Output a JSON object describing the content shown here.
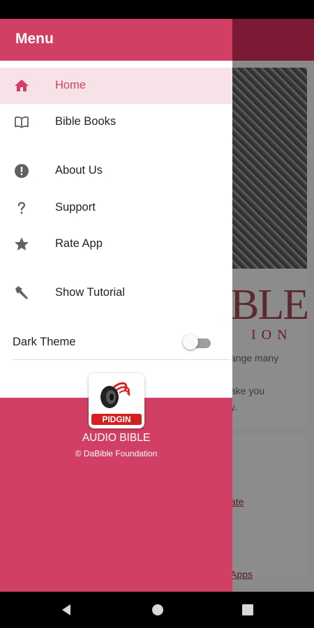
{
  "drawer": {
    "title": "Menu",
    "items": [
      {
        "label": "Home",
        "icon": "home-icon",
        "active": true
      },
      {
        "label": "Bible Books",
        "icon": "book-icon"
      },
      {
        "label": "About Us",
        "icon": "info-icon"
      },
      {
        "label": "Support",
        "icon": "question-icon"
      },
      {
        "label": "Rate App",
        "icon": "star-icon"
      },
      {
        "label": "Show Tutorial",
        "icon": "hammer-icon"
      }
    ],
    "dark_theme": {
      "label": "Dark Theme",
      "enabled": false
    },
    "footer": {
      "logo_badge": "PIDGIN",
      "app_name": "AUDIO BIBLE",
      "copyright": "© DaBible Foundation"
    }
  },
  "background": {
    "heading": "BLE",
    "subheading": "ION",
    "text_lines": [
      "ange many",
      "ake you",
      "y."
    ],
    "links": [
      "ate",
      "Apps"
    ]
  },
  "colors": {
    "accent": "#d23f64",
    "active_bg": "#f7e2e8",
    "icon": "#616161"
  }
}
